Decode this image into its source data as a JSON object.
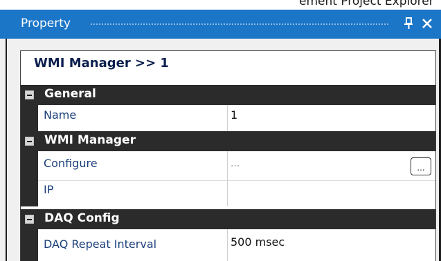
{
  "window": {
    "above_title_partial": "ement Project Explorer"
  },
  "panel": {
    "title": "Property",
    "pin_icon": "pin-icon",
    "close_icon": "close-icon"
  },
  "grid": {
    "object_title": "WMI Manager >> 1",
    "categories": [
      {
        "label": "General",
        "properties": [
          {
            "name": "Name",
            "value": "1"
          }
        ]
      },
      {
        "label": "WMI Manager",
        "properties": [
          {
            "name": "Configure",
            "value": "...",
            "button_label": "..."
          },
          {
            "name": "IP",
            "value": ""
          }
        ]
      },
      {
        "label": "DAQ Config",
        "properties": [
          {
            "name": "DAQ Repeat Interval",
            "value": "500 msec"
          }
        ]
      }
    ]
  },
  "colors": {
    "titlebar": "#1c76c8",
    "category_row": "#2b2b2b",
    "property_name": "#1b3f7a",
    "object_title": "#0b1f4d"
  }
}
